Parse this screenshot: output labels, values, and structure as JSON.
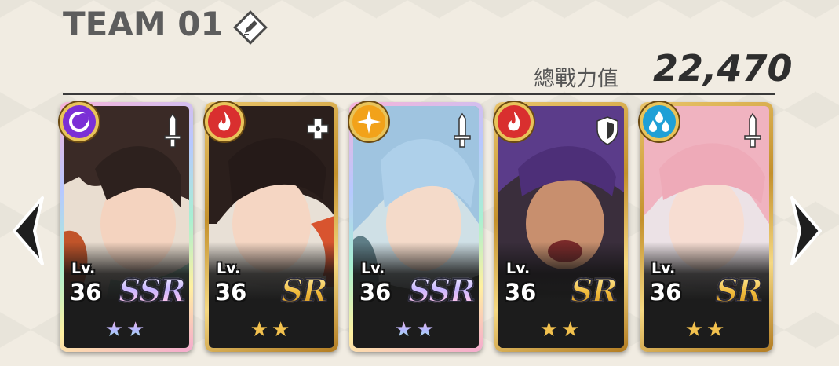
{
  "team": {
    "title": "TEAM 01",
    "edit_icon": "edit-pencil-icon"
  },
  "power": {
    "label": "總戰力值",
    "value": "22,470"
  },
  "nav": {
    "prev_icon": "chevron-left-icon",
    "next_icon": "chevron-right-icon"
  },
  "cards": [
    {
      "level_label": "Lv.",
      "level": "36",
      "rarity": "SSR",
      "stars": "★★",
      "element": "dark-element-icon",
      "element_color": "#7b2fd6",
      "role": "sword-icon",
      "frame": "rainbow"
    },
    {
      "level_label": "Lv.",
      "level": "36",
      "rarity": "SR",
      "stars": "★★",
      "element": "fire-element-icon",
      "element_color": "#d92f2f",
      "role": "heal-cross-icon",
      "frame": "gold"
    },
    {
      "level_label": "Lv.",
      "level": "36",
      "rarity": "SSR",
      "stars": "★★",
      "element": "light-element-icon",
      "element_color": "#f2a21a",
      "role": "sword-icon",
      "frame": "rainbow"
    },
    {
      "level_label": "Lv.",
      "level": "36",
      "rarity": "SR",
      "stars": "★★",
      "element": "fire-element-icon",
      "element_color": "#d92f2f",
      "role": "shield-icon",
      "frame": "gold"
    },
    {
      "level_label": "Lv.",
      "level": "36",
      "rarity": "SR",
      "stars": "★★",
      "element": "water-element-icon",
      "element_color": "#1fa0d6",
      "role": "sword-icon",
      "frame": "gold"
    }
  ],
  "colors": {
    "background": "#f1ece2",
    "title": "#5d5d5d",
    "power_value": "#2e2e2e"
  }
}
